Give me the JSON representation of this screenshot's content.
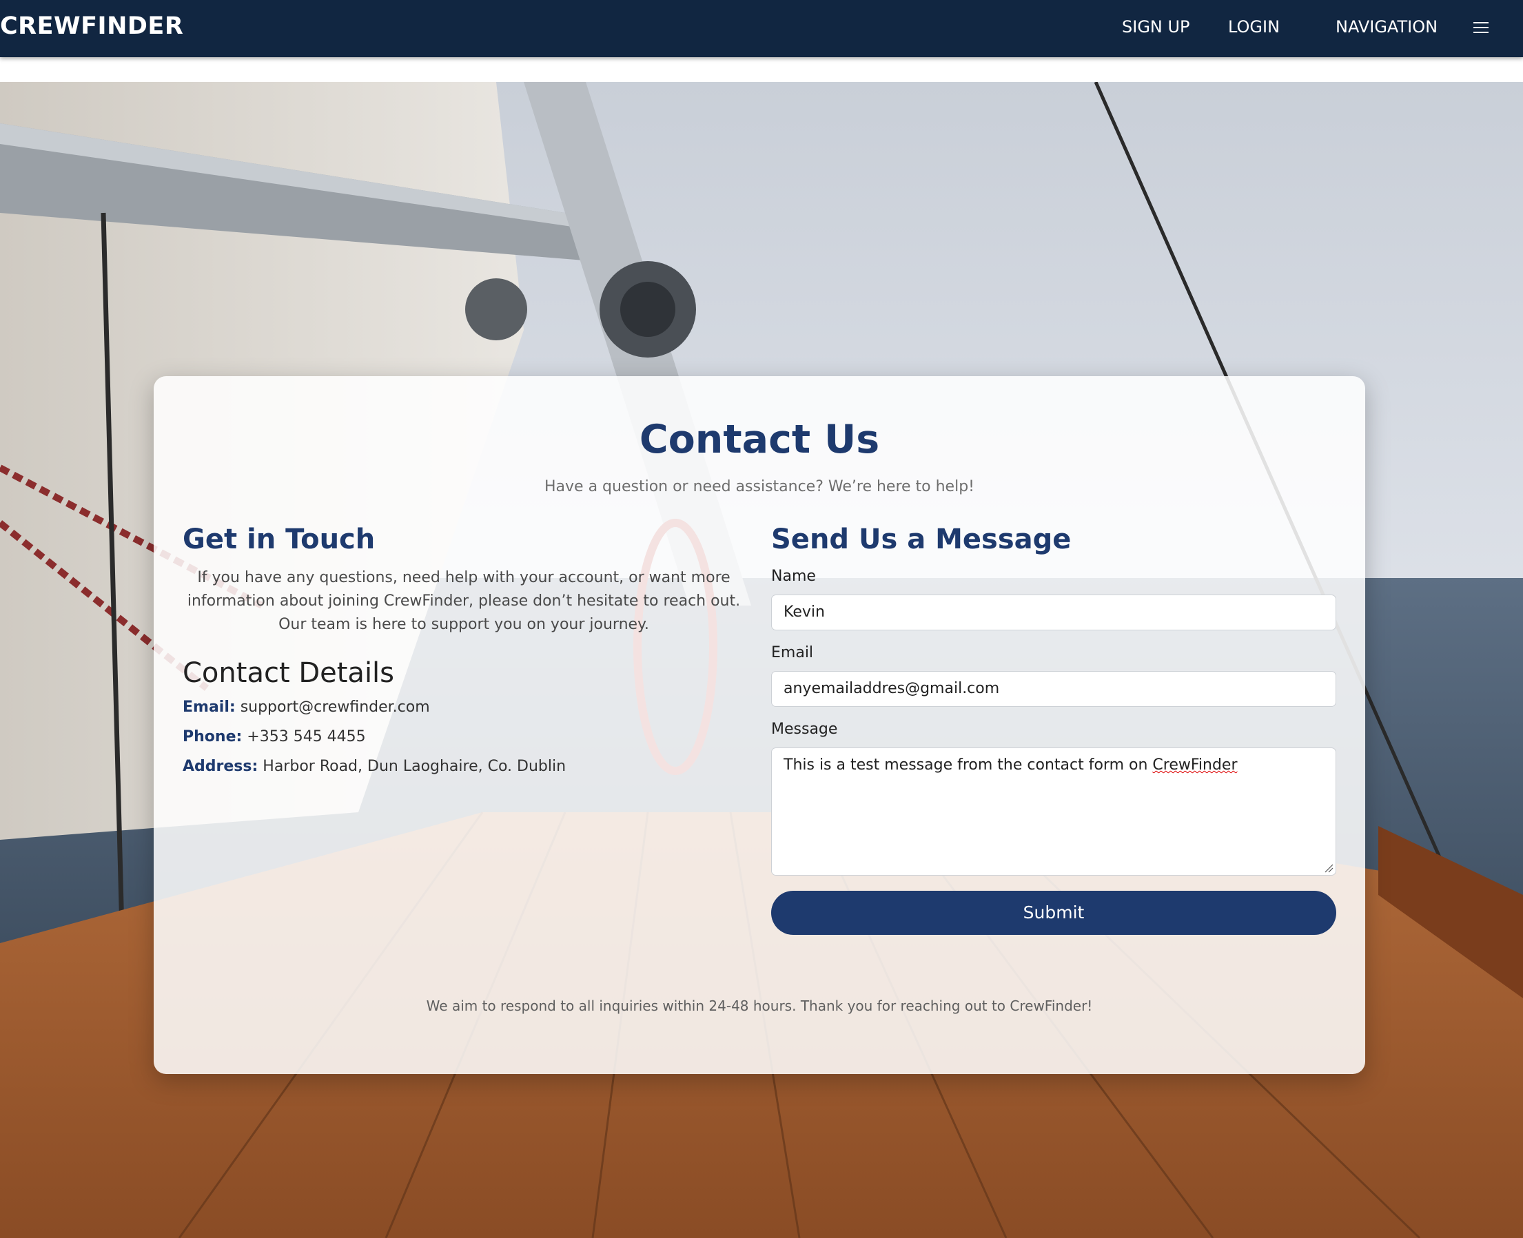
{
  "navbar": {
    "brand": "CREWFINDER",
    "signup_label": "SIGN UP",
    "login_label": "LOGIN",
    "navigation_label": "NAVIGATION",
    "menu_icon": "hamburger-menu-icon"
  },
  "hero": {
    "image": "sailboat-deck-photo"
  },
  "contact": {
    "title": "Contact Us",
    "subtitle": "Have a question or need assistance? We’re here to help!",
    "get_in_touch": {
      "heading": "Get in Touch",
      "text": "If you have any questions, need help with your account, or want more information about joining CrewFinder, please don’t hesitate to reach out. Our team is here to support you on your journey."
    },
    "details": {
      "heading": "Contact Details",
      "email_label": "Email:",
      "email_value": "support@crewfinder.com",
      "phone_label": "Phone:",
      "phone_value": "+353 545 4455",
      "address_label": "Address:",
      "address_value": "Harbor Road, Dun Laoghaire, Co. Dublin"
    },
    "form": {
      "heading": "Send Us a Message",
      "name_label": "Name",
      "name_value": "Kevin",
      "email_label": "Email",
      "email_value": "anyemailaddres@gmail.com",
      "message_label": "Message",
      "message_value_prefix": "This is a test message from the contact form on ",
      "message_value_flagged": "CrewFinder",
      "submit_label": "Submit"
    },
    "footer_note": "We aim to respond to all inquiries within 24-48 hours. Thank you for reaching out to CrewFinder!"
  },
  "colors": {
    "navbar_bg": "#112641",
    "accent": "#1e3a6e",
    "card_bg": "rgba(255,255,255,0.86)"
  }
}
